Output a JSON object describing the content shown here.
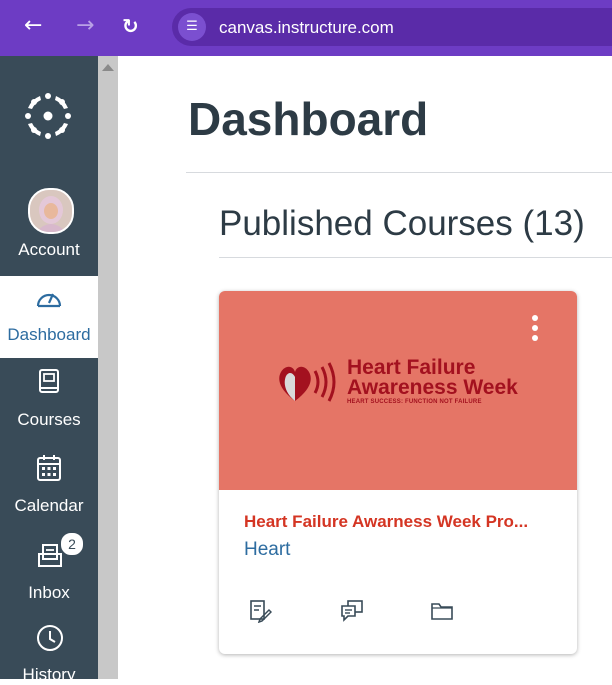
{
  "browser": {
    "back_icon": "arrow-left-icon",
    "forward_icon": "arrow-right-icon",
    "reload_icon": "reload-icon",
    "site_settings_icon": "tune-icon",
    "url": "canvas.instructure.com",
    "bar_color": "#6d3cc4"
  },
  "sidebar": {
    "background": "#394b58",
    "logo_icon": "canvas-logo-icon",
    "items": [
      {
        "label": "Account",
        "icon": "avatar-icon",
        "active": false
      },
      {
        "label": "Dashboard",
        "icon": "dashboard-icon",
        "active": true
      },
      {
        "label": "Courses",
        "icon": "courses-icon",
        "active": false
      },
      {
        "label": "Calendar",
        "icon": "calendar-icon",
        "active": false
      },
      {
        "label": "Inbox",
        "icon": "inbox-icon",
        "active": false,
        "badge": "2"
      },
      {
        "label": "History",
        "icon": "clock-icon",
        "active": false
      }
    ]
  },
  "main": {
    "title": "Dashboard",
    "section_title": "Published Courses (13)",
    "courses": [
      {
        "hero_color": "#e57566",
        "hero_line1": "Heart Failure",
        "hero_line2": "Awareness Week",
        "hero_tagline": "HEART SUCCESS: FUNCTION NOT FAILURE",
        "name": "Heart Failure Awarness Week Pro...",
        "code": "Heart",
        "name_color": "#d43523",
        "actions": [
          "assignments-icon",
          "discussions-icon",
          "files-icon"
        ]
      }
    ]
  }
}
